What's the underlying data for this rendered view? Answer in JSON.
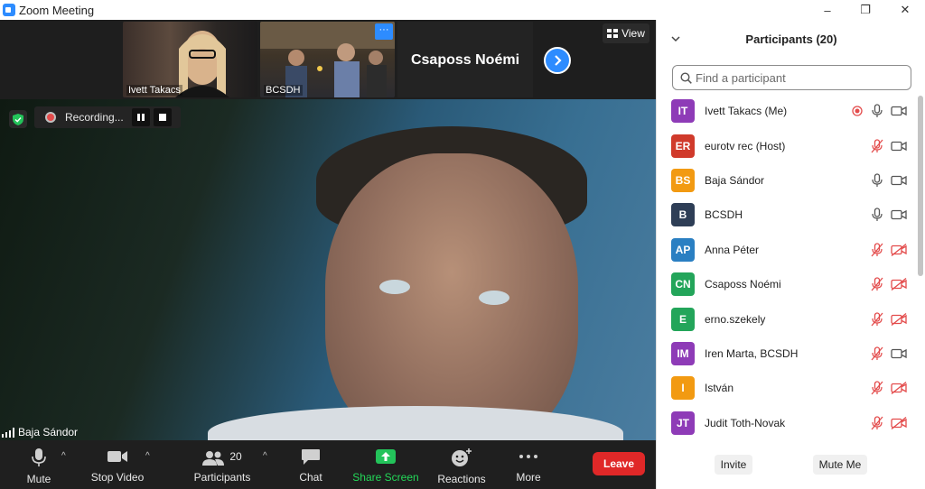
{
  "window": {
    "title": "Zoom Meeting",
    "controls": {
      "minimize": "–",
      "restore": "❐",
      "close": "✕"
    }
  },
  "gallery": {
    "tiles": [
      {
        "name": "Ivett Takacs"
      },
      {
        "name": "BCSDH",
        "more": "···"
      }
    ],
    "audio_only_tile": {
      "name": "Csaposs Noémi"
    },
    "next_icon": "chevron-right-icon",
    "view_label": "View"
  },
  "recording": {
    "label": "Recording..."
  },
  "main_video": {
    "speaker": "Baja Sándor"
  },
  "toolbar": {
    "mute": "Mute",
    "stop_video": "Stop Video",
    "participants": "Participants",
    "participants_count": "20",
    "chat": "Chat",
    "share_screen": "Share Screen",
    "reactions": "Reactions",
    "more": "More",
    "leave": "Leave"
  },
  "panel": {
    "title": "Participants (20)",
    "search_placeholder": "Find a participant",
    "participants": [
      {
        "initials": "IT",
        "name": "Ivett Takacs (Me)",
        "color": "#8e3bb7",
        "recording": true,
        "mic": "on",
        "video": "on"
      },
      {
        "initials": "ER",
        "name": "eurotv rec (Host)",
        "color": "#d03a2b",
        "recording": false,
        "mic": "muted",
        "video": "on"
      },
      {
        "initials": "BS",
        "name": "Baja Sándor",
        "color": "#f29a12",
        "recording": false,
        "mic": "on",
        "video": "on"
      },
      {
        "initials": "B",
        "name": "BCSDH",
        "color": "#2e3e56",
        "recording": false,
        "mic": "on",
        "video": "on"
      },
      {
        "initials": "AP",
        "name": "Anna Péter",
        "color": "#2a7fc2",
        "recording": false,
        "mic": "muted",
        "video": "off"
      },
      {
        "initials": "CN",
        "name": "Csaposs Noémi",
        "color": "#23a55a",
        "recording": false,
        "mic": "muted",
        "video": "off"
      },
      {
        "initials": "E",
        "name": "erno.szekely",
        "color": "#23a55a",
        "recording": false,
        "mic": "muted",
        "video": "off"
      },
      {
        "initials": "IM",
        "name": "Iren Marta, BCSDH",
        "color": "#8e3bb7",
        "recording": false,
        "mic": "muted",
        "video": "on"
      },
      {
        "initials": "I",
        "name": "István",
        "color": "#f29a12",
        "recording": false,
        "mic": "muted",
        "video": "off"
      },
      {
        "initials": "JT",
        "name": "Judit Toth-Novak",
        "color": "#8e3bb7",
        "recording": false,
        "mic": "muted",
        "video": "off"
      }
    ],
    "invite": "Invite",
    "mute_me": "Mute Me"
  }
}
